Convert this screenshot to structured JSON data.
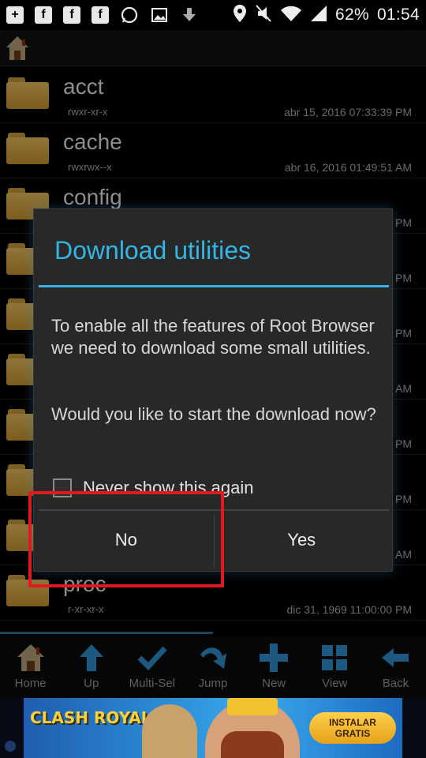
{
  "status_bar": {
    "battery": "62%",
    "time": "01:54",
    "icons": [
      "add-box-icon",
      "facebook-icon",
      "facebook-icon",
      "facebook-icon",
      "whatsapp-icon",
      "image-icon",
      "download-icon",
      "location-icon",
      "mute-icon",
      "wifi-icon",
      "signal-icon"
    ]
  },
  "files": [
    {
      "name": "acct",
      "perm": "rwxr-xr-x",
      "date": "abr 15, 2016 07:33:39 PM"
    },
    {
      "name": "cache",
      "perm": "rwxrwx--x",
      "date": "abr 16, 2016 01:49:51 AM"
    },
    {
      "name": "config",
      "perm": "",
      "date": "PM"
    },
    {
      "name": "",
      "perm": "",
      "date": "PM"
    },
    {
      "name": "",
      "perm": "",
      "date": "PM"
    },
    {
      "name": "",
      "perm": "",
      "date": "AM"
    },
    {
      "name": "",
      "perm": "",
      "date": "PM"
    },
    {
      "name": "",
      "perm": "",
      "date": "PM"
    },
    {
      "name": "",
      "perm": "",
      "date": "AM"
    },
    {
      "name": "proc",
      "perm": "r-xr-xr-x",
      "date": "dic 31, 1969 11:00:00 PM"
    }
  ],
  "toolbar": {
    "home": "Home",
    "up": "Up",
    "multisel": "Multi-Sel",
    "jump": "Jump",
    "new": "New",
    "view": "View",
    "back": "Back"
  },
  "dialog": {
    "title": "Download utilities",
    "message": "To enable all the features of Root Browser we need to download some small utilities.",
    "question": "Would you like to start the download now?",
    "checkbox_label": "Never show this again",
    "checkbox_checked": false,
    "no_label": "No",
    "yes_label": "Yes"
  },
  "ad": {
    "brand": "CLASH ROYALE",
    "cta_line1": "INSTALAR",
    "cta_line2": "GRATIS"
  },
  "colors": {
    "accent": "#33b5e5",
    "highlight": "#e0191f",
    "toolbar_icon": "#2f8fd0"
  }
}
